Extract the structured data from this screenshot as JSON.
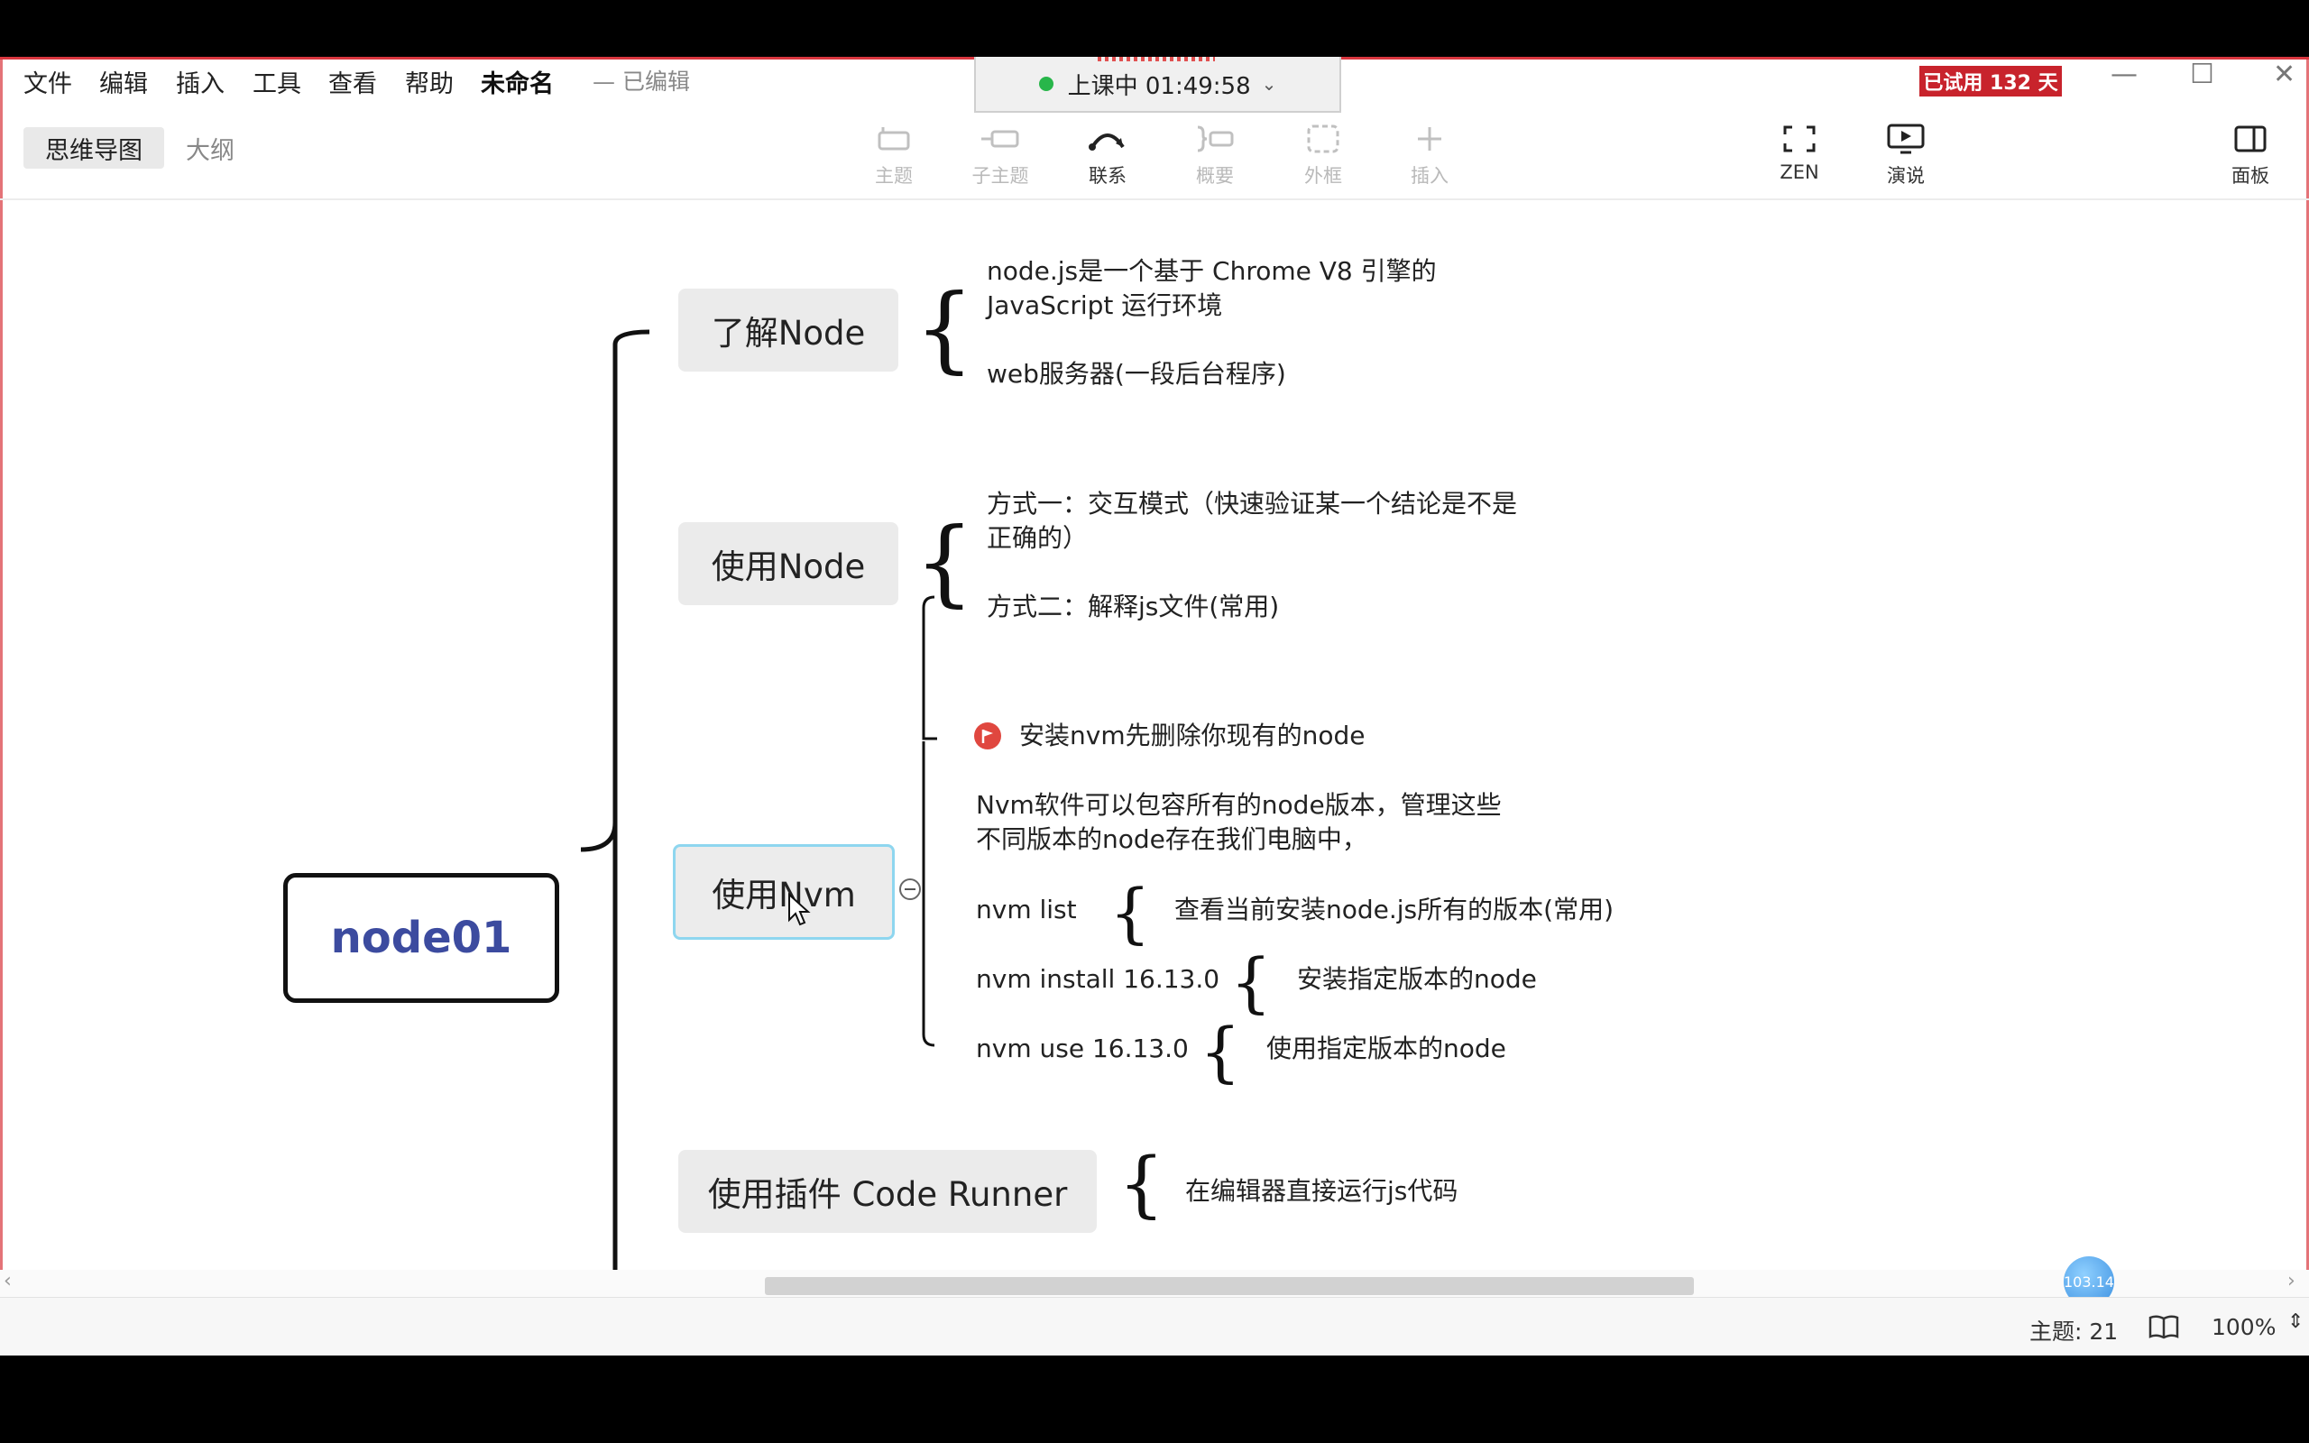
{
  "menu": {
    "items": [
      "文件",
      "编辑",
      "插入",
      "工具",
      "查看",
      "帮助"
    ],
    "doc_title": "未命名",
    "doc_status": "— 已编辑"
  },
  "timer": {
    "label": "上课中 01:49:58"
  },
  "trial": {
    "label": "已试用 132 天"
  },
  "view_tabs": {
    "mindmap": "思维导图",
    "outline": "大纲"
  },
  "toolbar": {
    "topic": "主题",
    "subtopic": "子主题",
    "relation": "联系",
    "summary": "概要",
    "boundary": "外框",
    "insert": "插入",
    "zen": "ZEN",
    "present": "演说",
    "panel": "面板"
  },
  "mindmap": {
    "root": "node01",
    "branches": [
      {
        "label": "了解Node",
        "children": [
          "node.js是一个基于 Chrome V8 引擎的",
          "JavaScript 运行环境",
          "web服务器(一段后台程序)"
        ]
      },
      {
        "label": "使用Node",
        "children": [
          "方式一：交互模式（快速验证某一个结论是不是",
          "正确的）",
          "方式二：解释js文件(常用)"
        ]
      },
      {
        "label": "使用Nvm",
        "children": [
          "安装nvm先删除你现有的node",
          "Nvm软件可以包容所有的node版本，管理这些",
          "不同版本的node存在我们电脑中，",
          "nvm list",
          "nvm install 16.13.0",
          "nvm use 16.13.0"
        ],
        "sub_details": [
          "查看当前安装node.js所有的版本(常用)",
          "安装指定版本的node",
          "使用指定版本的node"
        ]
      },
      {
        "label": "使用插件 Code Runner",
        "children": [
          "在编辑器直接运行js代码"
        ]
      }
    ]
  },
  "floating_badge": "103.14",
  "status": {
    "topics": "主题: 21",
    "zoom": "100%"
  },
  "colors": {
    "accent_red": "#c8232c",
    "root_text": "#3c4b9f",
    "selected_border": "#8ed6ef"
  }
}
